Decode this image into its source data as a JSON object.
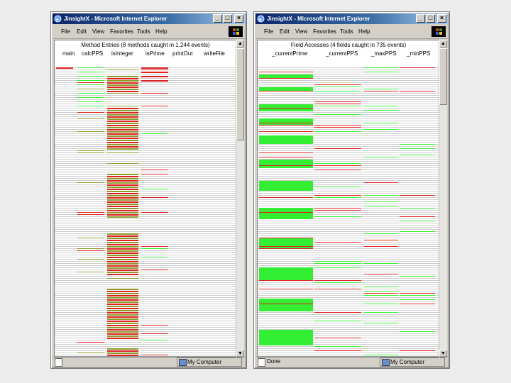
{
  "windows": [
    {
      "id": "w1",
      "title": "JinsightX - Microsoft Internet Explorer",
      "menu": [
        "File",
        "Edit",
        "View",
        "Favorites",
        "Tools",
        "Help"
      ],
      "panel_title": "Method Entries (8 methods caught in 1,244 events)",
      "columns": [
        "main",
        "calcPPS",
        "isInteger",
        "isPrime",
        "printOut",
        "writeFile"
      ],
      "status": "",
      "zone": "My Computer"
    },
    {
      "id": "w2",
      "title": "JinsightX - Microsoft Internet Explorer",
      "menu": [
        "File",
        "Edit",
        "View",
        "Favorites",
        "Tools",
        "Help"
      ],
      "panel_title": "Field Accesses (4 fields caught in 735 events)",
      "columns": [
        "_currentPrime",
        "_currentPPS",
        "_maxPPS",
        "_minPPS"
      ],
      "status": "Done",
      "zone": "My Computer"
    }
  ],
  "colors": {
    "green": "#33ee33",
    "red": "#dd2222",
    "olive": "#8a9a2a",
    "grey_line": "#cccccc",
    "title_bar": "#0a246a"
  }
}
